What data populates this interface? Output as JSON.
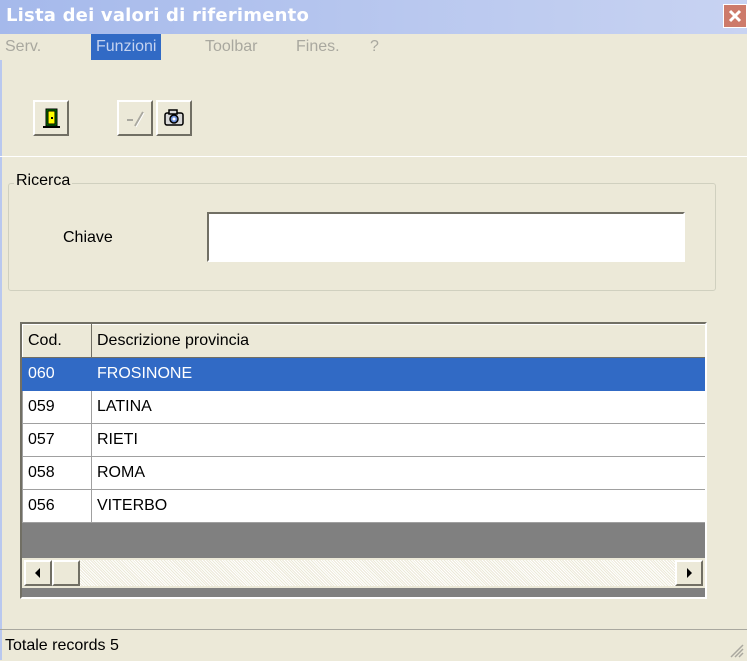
{
  "window": {
    "title": "Lista dei valori di riferimento",
    "close_icon": "close-icon"
  },
  "menu": {
    "items": [
      {
        "label": "Serv.",
        "active": false
      },
      {
        "label": "Funzioni",
        "active": true
      },
      {
        "label": "Toolbar",
        "active": false
      },
      {
        "label": "Fines.",
        "active": false
      },
      {
        "label": "?",
        "active": false
      }
    ]
  },
  "toolbar": {
    "buttons": [
      {
        "icon": "exit-door-icon",
        "enabled": true
      },
      {
        "icon": "edit-disabled-icon",
        "enabled": false
      },
      {
        "icon": "camera-icon",
        "enabled": true
      }
    ]
  },
  "search": {
    "group_label": "Ricerca",
    "key_label": "Chiave",
    "key_value": ""
  },
  "grid": {
    "columns": [
      "Cod.",
      "Descrizione provincia"
    ],
    "rows": [
      {
        "cod": "060",
        "desc": "FROSINONE",
        "selected": true
      },
      {
        "cod": "059",
        "desc": "LATINA",
        "selected": false
      },
      {
        "cod": "057",
        "desc": "RIETI",
        "selected": false
      },
      {
        "cod": "058",
        "desc": "ROMA",
        "selected": false
      },
      {
        "cod": "056",
        "desc": "VITERBO",
        "selected": false
      }
    ]
  },
  "status": {
    "text": "Totale records 5"
  },
  "colors": {
    "selection": "#316ac5",
    "titlebar": "#a5b9eb",
    "face": "#ece9d8"
  }
}
